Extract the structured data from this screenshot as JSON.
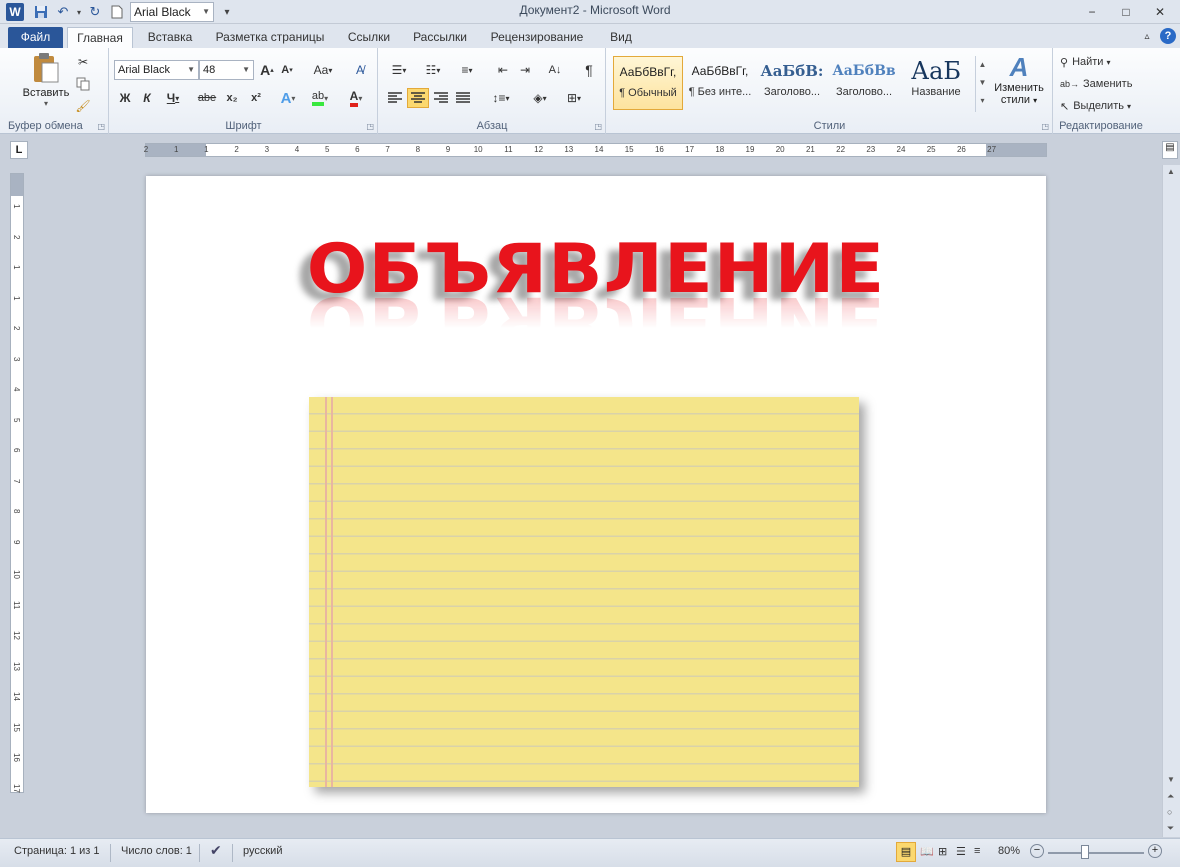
{
  "app": {
    "icon": "word-icon",
    "title": "Документ2 - Microsoft Word"
  },
  "quick_access": {
    "font_value": "Arial Black"
  },
  "window_controls": {
    "minimize": "−",
    "restore": "□",
    "close": "✕"
  },
  "tabs": [
    {
      "label": "Файл"
    },
    {
      "label": "Главная"
    },
    {
      "label": "Вставка"
    },
    {
      "label": "Разметка страницы"
    },
    {
      "label": "Ссылки"
    },
    {
      "label": "Рассылки"
    },
    {
      "label": "Рецензирование"
    },
    {
      "label": "Вид"
    }
  ],
  "ribbon": {
    "clipboard": {
      "label": "Буфер обмена",
      "paste_label": "Вставить"
    },
    "font": {
      "label": "Шрифт",
      "font_name": "Arial Black",
      "font_size": "48",
      "bold": "Ж",
      "italic": "К",
      "underline": "Ч",
      "strike": "abe",
      "sub": "x₂",
      "sup": "x²",
      "case": "Aa"
    },
    "paragraph": {
      "label": "Абзац",
      "pilcrow": "¶"
    },
    "styles": {
      "label": "Стили",
      "items": [
        {
          "sample": "АаБбВвГг,",
          "name": "¶ Обычный"
        },
        {
          "sample": "АаБбВвГг,",
          "name": "¶ Без инте..."
        },
        {
          "sample": "АаБбВ:",
          "name": "Заголово..."
        },
        {
          "sample": "АаБбВв",
          "name": "Заголово..."
        },
        {
          "sample": "АаБ",
          "name": "Название"
        }
      ],
      "change_label_1": "Изменить",
      "change_label_2": "стили"
    },
    "editing": {
      "label": "Редактирование",
      "find": "Найти",
      "replace": "Заменить",
      "select": "Выделить"
    }
  },
  "ruler": {
    "h_labels": [
      "2",
      "1",
      "1",
      "2",
      "3",
      "4",
      "5",
      "6",
      "7",
      "8",
      "9",
      "10",
      "11",
      "12",
      "13",
      "14",
      "15",
      "16",
      "17",
      "18",
      "19",
      "20",
      "21",
      "22",
      "23",
      "24",
      "25",
      "26",
      "27"
    ],
    "v_labels": [
      "1",
      "2",
      "1",
      "1",
      "2",
      "3",
      "4",
      "5",
      "6",
      "7",
      "8",
      "9",
      "10",
      "11",
      "12",
      "13",
      "14",
      "15",
      "16",
      "17"
    ]
  },
  "document": {
    "headline": "ОБЪЯВЛЕНИЕ"
  },
  "status": {
    "page": "Страница: 1 из 1",
    "words": "Число слов: 1",
    "language": "русский",
    "zoom": "80%",
    "zoom_level": 0.8
  },
  "colors": {
    "accent": "#2a5699",
    "headline": "#e8141c",
    "notepad": "#f4e58a"
  }
}
